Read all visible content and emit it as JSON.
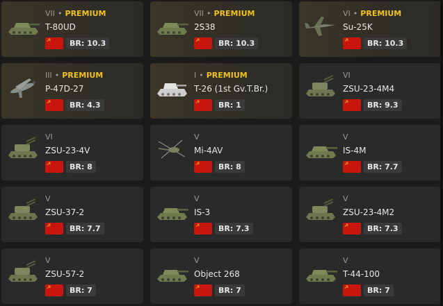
{
  "br_prefix": "BR: ",
  "premium_label": "PREMIUM",
  "separator": "•",
  "vehicles": [
    {
      "rank": "VII",
      "premium": true,
      "name": "T-80UD",
      "br": "10.3",
      "type": "tank",
      "icon": "tank-icon"
    },
    {
      "rank": "VII",
      "premium": true,
      "name": "2S38",
      "br": "10.3",
      "type": "tank",
      "icon": "tank-icon"
    },
    {
      "rank": "VI",
      "premium": true,
      "name": "Su-25K",
      "br": "10.3",
      "type": "jet",
      "icon": "jet-icon"
    },
    {
      "rank": "III",
      "premium": true,
      "name": "P-47D-27",
      "br": "4.3",
      "type": "prop",
      "icon": "propeller-plane-icon"
    },
    {
      "rank": "I",
      "premium": true,
      "name": "T-26 (1st Gv.T.Br.)",
      "br": "1",
      "type": "tank-white",
      "icon": "tank-icon"
    },
    {
      "rank": "VI",
      "premium": false,
      "name": "ZSU-23-4M4",
      "br": "9.3",
      "type": "spaa",
      "icon": "spaa-icon"
    },
    {
      "rank": "VI",
      "premium": false,
      "name": "ZSU-23-4V",
      "br": "8",
      "type": "spaa",
      "icon": "spaa-icon"
    },
    {
      "rank": "V",
      "premium": false,
      "name": "Mi-4AV",
      "br": "8",
      "type": "heli",
      "icon": "helicopter-icon"
    },
    {
      "rank": "V",
      "premium": false,
      "name": "IS-4M",
      "br": "7.7",
      "type": "tank",
      "icon": "tank-icon"
    },
    {
      "rank": "V",
      "premium": false,
      "name": "ZSU-37-2",
      "br": "7.7",
      "type": "spaa",
      "icon": "spaa-icon"
    },
    {
      "rank": "V",
      "premium": false,
      "name": "IS-3",
      "br": "7.3",
      "type": "tank",
      "icon": "tank-icon"
    },
    {
      "rank": "V",
      "premium": false,
      "name": "ZSU-23-4M2",
      "br": "7.3",
      "type": "spaa",
      "icon": "spaa-icon"
    },
    {
      "rank": "V",
      "premium": false,
      "name": "ZSU-57-2",
      "br": "7",
      "type": "spaa",
      "icon": "spaa-icon"
    },
    {
      "rank": "V",
      "premium": false,
      "name": "Object 268",
      "br": "7",
      "type": "tank",
      "icon": "tank-icon"
    },
    {
      "rank": "V",
      "premium": false,
      "name": "T-44-100",
      "br": "7",
      "type": "tank",
      "icon": "tank-icon"
    }
  ]
}
